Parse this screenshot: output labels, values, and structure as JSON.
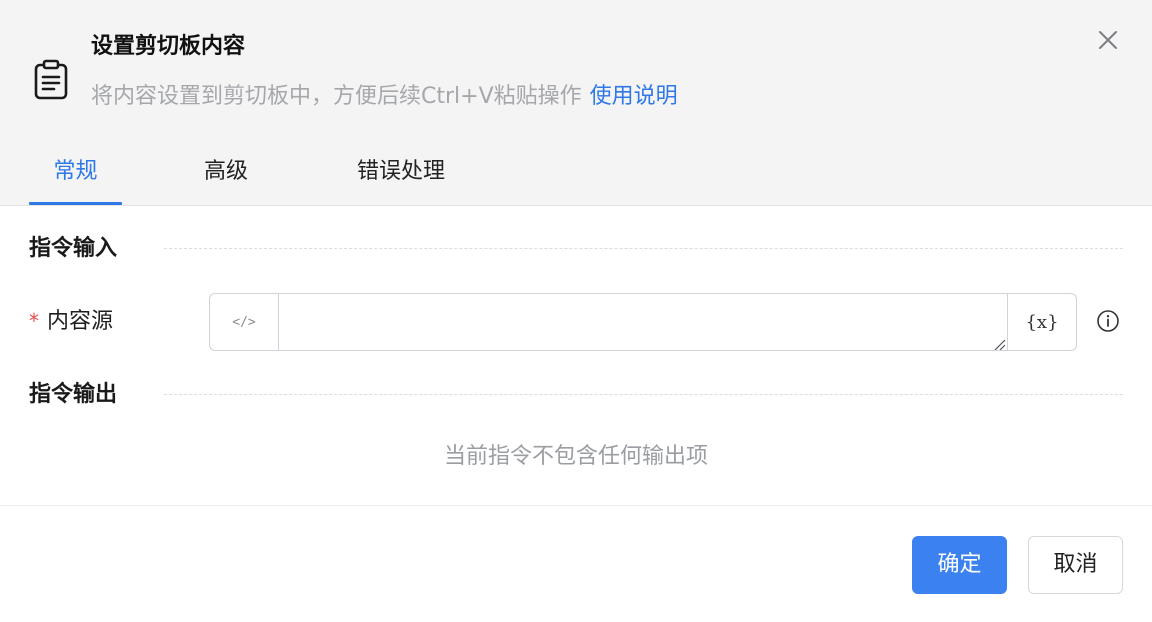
{
  "dialog": {
    "title": "设置剪切板内容",
    "subtitle": "将内容设置到剪切板中，方便后续Ctrl+V粘贴操作",
    "help_link": "使用说明",
    "header_icon": "clipboard-icon",
    "close_icon": "close-icon"
  },
  "tabs": [
    {
      "label": "常规",
      "active": true
    },
    {
      "label": "高级",
      "active": false
    },
    {
      "label": "错误处理",
      "active": false
    }
  ],
  "input_section": {
    "title": "指令输入",
    "fields": [
      {
        "required_mark": "*",
        "label": "内容源",
        "value": "",
        "prefix_icon": "</>",
        "suffix_icon": "{x}",
        "info_icon": "info-icon"
      }
    ]
  },
  "output_section": {
    "title": "指令输出",
    "empty_text": "当前指令不包含任何输出项"
  },
  "footer": {
    "confirm_label": "确定",
    "cancel_label": "取消"
  },
  "colors": {
    "accent": "#2f78e6",
    "primary_button": "#3b82f0",
    "required": "#ea4d4d",
    "header_bg": "#f4f4f5"
  }
}
